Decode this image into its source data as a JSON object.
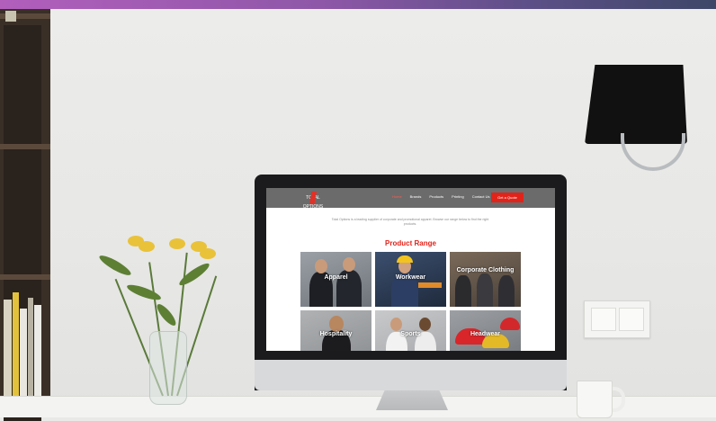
{
  "website": {
    "logo_text": "TOTAL OPTIONS",
    "nav_items": [
      {
        "label": "Home",
        "active": true
      },
      {
        "label": "Brands",
        "active": false
      },
      {
        "label": "Products",
        "active": false
      },
      {
        "label": "Printing",
        "active": false
      },
      {
        "label": "Contact Us",
        "active": false
      }
    ],
    "cta_label": "Get a Quote",
    "intro_text": "Total Options is a leading supplier of corporate and promotional apparel. Browse our range below to find the right products.",
    "section_heading": "Product Range",
    "categories": [
      {
        "label": "Apparel"
      },
      {
        "label": "Workwear"
      },
      {
        "label": "Corporate Clothing"
      },
      {
        "label": "Hospitality"
      },
      {
        "label": "Sports"
      },
      {
        "label": "Headwear"
      }
    ]
  },
  "colors": {
    "brand_red": "#e2231a",
    "nav_gray": "#6b6b6b",
    "top_gradient_start": "#b25fbc",
    "top_gradient_end": "#3e4768"
  },
  "icons": [
    "desk-lamp-icon",
    "light-switch-icon",
    "coffee-mug-icon",
    "flower-vase-icon",
    "bookshelf-icon"
  ]
}
